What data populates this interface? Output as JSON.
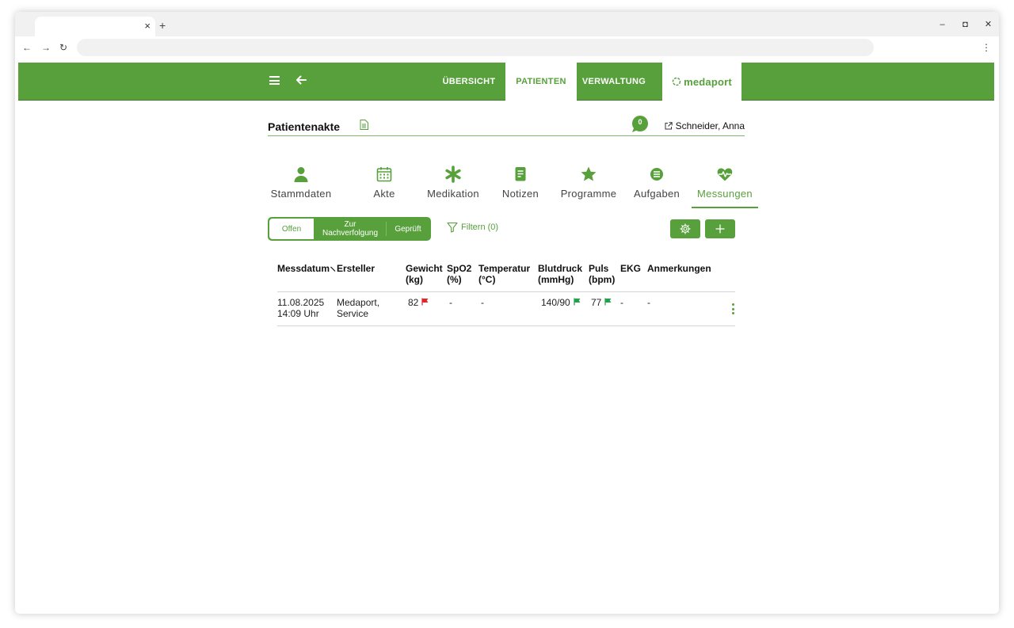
{
  "browser": {
    "tab_close": "×",
    "new_tab": "+",
    "minimize": "–",
    "restore": "◘",
    "close": "✕",
    "back": "←",
    "forward": "→",
    "reload": "↻",
    "menu": "⋮"
  },
  "header": {
    "nav": [
      "ÜBERSICHT",
      "PATIENTEN",
      "VERWALTUNG"
    ],
    "active_nav": "PATIENTEN",
    "logo": "medaport",
    "color": "#57a03b"
  },
  "record": {
    "title": "Patientenakte",
    "notification_count": "0",
    "patient_name": "Schneider, Anna"
  },
  "categories": [
    {
      "label": "Stammdaten",
      "icon": "person-icon"
    },
    {
      "label": "Akte",
      "icon": "calendar-icon"
    },
    {
      "label": "Medikation",
      "icon": "asterisk-icon"
    },
    {
      "label": "Notizen",
      "icon": "note-icon"
    },
    {
      "label": "Programme",
      "icon": "star-icon"
    },
    {
      "label": "Aufgaben",
      "icon": "list-icon"
    },
    {
      "label": "Messungen",
      "icon": "heart-pulse-icon"
    }
  ],
  "active_category": "Messungen",
  "status_filter": {
    "open": "Offen",
    "followup_line1": "Zur",
    "followup_line2": "Nachverfolgung",
    "checked": "Geprüft"
  },
  "filter_label": "Filtern (0)",
  "table": {
    "headers": {
      "date": "Messdatum",
      "author": "Ersteller",
      "weight": [
        "Gewicht",
        "(kg)"
      ],
      "spo2": [
        "SpO2",
        "(%)"
      ],
      "temp": [
        "Temperatur",
        "(°C)"
      ],
      "bp": [
        "Blutdruck",
        "(mmHg)"
      ],
      "pulse": [
        "Puls",
        "(bpm)"
      ],
      "ecg": "EKG",
      "notes": "Anmerkungen"
    },
    "rows": [
      {
        "date": [
          "11.08.2025",
          "14:09 Uhr"
        ],
        "author": [
          "Medaport,",
          "Service"
        ],
        "weight": "82",
        "weight_flag": "red",
        "spo2": "-",
        "temp": "-",
        "bp": "140/90",
        "bp_flag": "green",
        "pulse": "77",
        "pulse_flag": "green",
        "ecg": "-",
        "notes": "-"
      }
    ]
  },
  "flag_colors": {
    "red": "#e0262b",
    "green": "#1fa34a"
  }
}
